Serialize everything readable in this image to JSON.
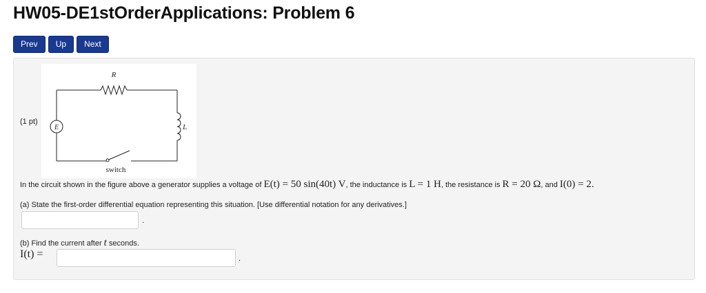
{
  "page": {
    "title": "HW05-DE1stOrderApplications: Problem 6"
  },
  "nav": {
    "prev": "Prev",
    "up": "Up",
    "next": "Next"
  },
  "problem": {
    "points": "(1 pt)",
    "figure": {
      "r_label": "R",
      "e_label": "E",
      "l_label": "L",
      "switch_label": "switch"
    },
    "intro": "In the circuit shown in the figure above a generator supplies a voltage of",
    "voltage_expr": "E(t) = 50 sin(40t) V",
    "inductance_lead": ", the inductance is",
    "inductance_expr": "L = 1 H",
    "resistance_lead": ", the resistance is",
    "resistance_expr": "R = 20 Ω",
    "initial_lead": ", and",
    "initial_expr": "I(0) = 2.",
    "part_a": "(a) State the first-order differential equation representing this situation. [Use differential notation for any derivatives.]",
    "part_a_input": {
      "value": "",
      "placeholder": ""
    },
    "part_a_terminator": ".",
    "part_b_prefix": "(b) Find the current after",
    "part_b_var": "t",
    "part_b_suffix": "seconds.",
    "part_b_label": "I(t) =",
    "part_b_input": {
      "value": "",
      "placeholder": ""
    },
    "part_b_terminator": "."
  }
}
